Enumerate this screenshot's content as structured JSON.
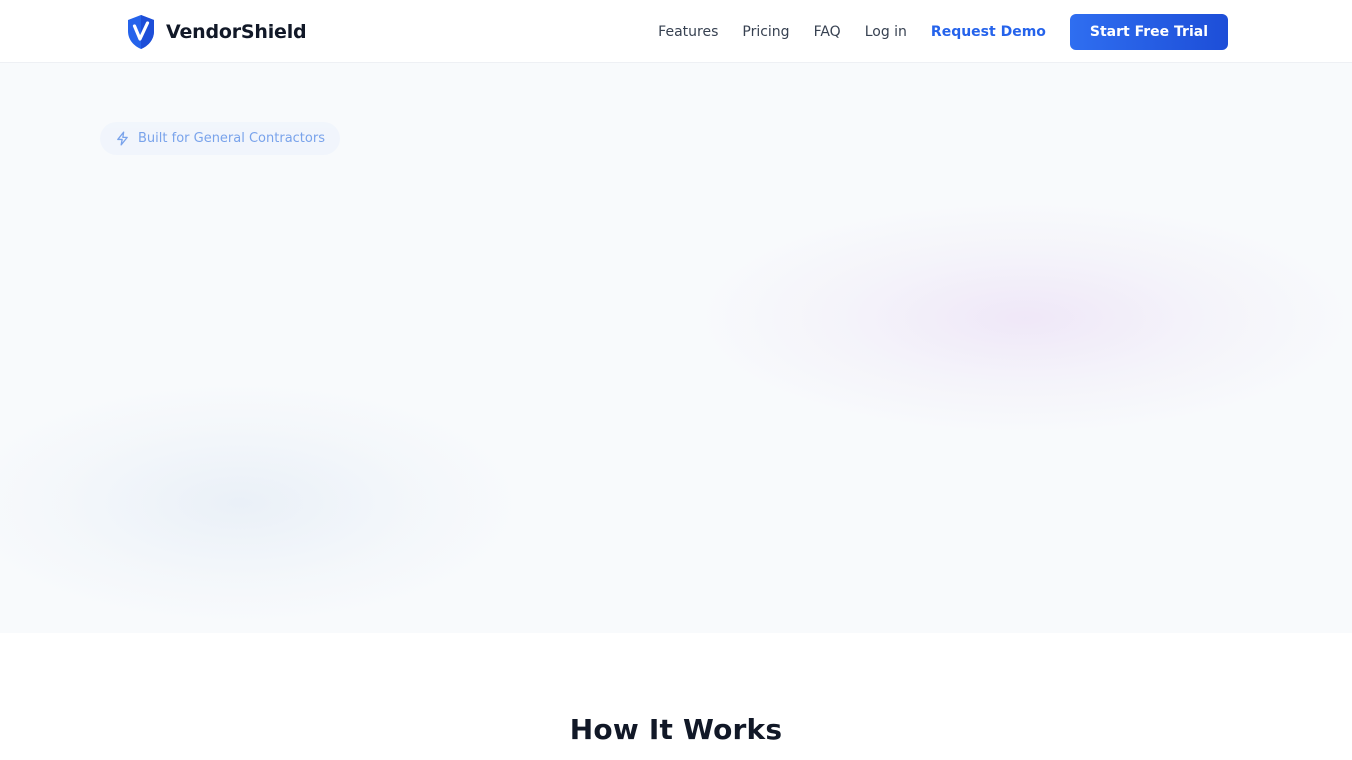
{
  "brand": {
    "name": "VendorShield",
    "logo_icon": "shield-check-icon",
    "colors": {
      "primary": "#2563eb",
      "primary_dark": "#1d4ed8",
      "text": "#111827"
    }
  },
  "nav": {
    "links": [
      "Features",
      "Pricing",
      "FAQ",
      "Log in"
    ],
    "demo_label": "Request Demo",
    "cta_label": "Start Free Trial"
  },
  "hero": {
    "badge_icon": "lightning-icon",
    "badge_text": "Built for General Contractors"
  },
  "how_it_works": {
    "title": "How It Works"
  }
}
